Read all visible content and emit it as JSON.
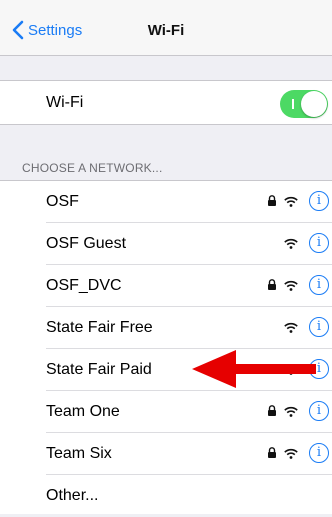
{
  "nav": {
    "back_label": "Settings",
    "title": "Wi-Fi"
  },
  "wifi_toggle": {
    "label": "Wi-Fi",
    "on": true,
    "color": "#4cd964"
  },
  "section": {
    "header": "CHOOSE A NETWORK..."
  },
  "networks": [
    {
      "name": "OSF",
      "locked": true
    },
    {
      "name": "OSF Guest",
      "locked": false
    },
    {
      "name": "OSF_DVC",
      "locked": true
    },
    {
      "name": "State Fair Free",
      "locked": false
    },
    {
      "name": "State Fair Paid",
      "locked": false
    },
    {
      "name": "Team One",
      "locked": true
    },
    {
      "name": "Team Six",
      "locked": true
    }
  ],
  "other_label": "Other...",
  "annotation": {
    "icon": "red-arrow-icon",
    "color": "#e60000"
  },
  "colors": {
    "accent": "#1a7cf5",
    "background": "#efeff4"
  }
}
